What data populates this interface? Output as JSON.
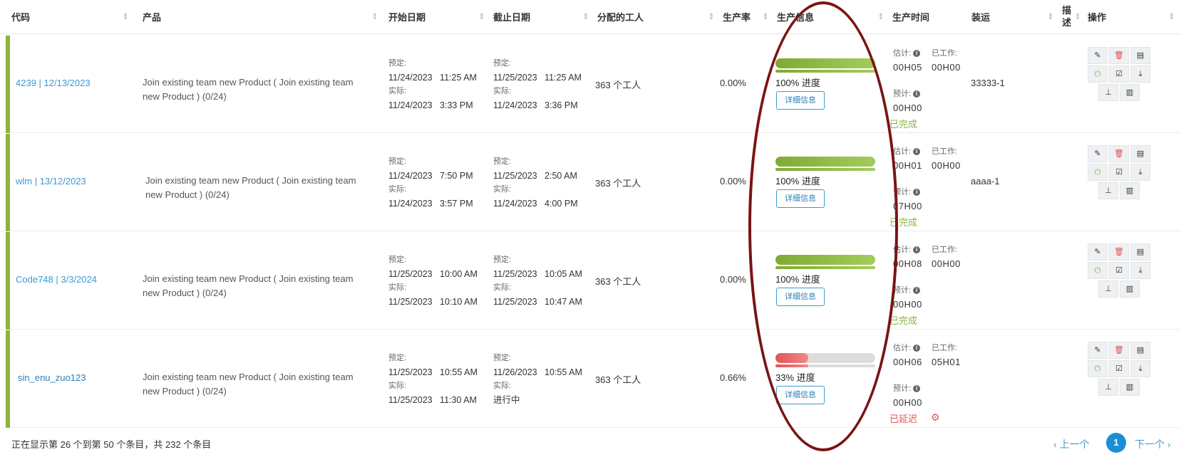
{
  "colors": {
    "accent": "#3c9ad0",
    "success": "#8ab43b",
    "danger": "#e05555",
    "annotation": "#7a1414"
  },
  "columns": [
    "代码",
    "产品",
    "开始日期",
    "截止日期",
    "分配的工人",
    "生产率",
    "生产信息",
    "生产时间",
    "装运",
    "描述",
    "操作"
  ],
  "labels": {
    "planned": "预定:",
    "actual": "实际:",
    "estimate": "估计:",
    "worked": "已工作:",
    "expected": "预计:",
    "detail": "详细信息"
  },
  "action_icons": [
    "edit-icon",
    "delete-icon",
    "file-icon",
    "power-icon",
    "check-icon",
    "download-icon",
    "hierarchy-icon",
    "barcode-icon"
  ],
  "rows": [
    {
      "code": "4239 | 12/13/2023",
      "product": "Join existing team new Product ( Join existing team new Product ) (0/24)",
      "start_planned": "11/24/2023   11:25 AM",
      "start_actual": "11/24/2023   3:33 PM",
      "end_planned": "11/25/2023   11:25 AM",
      "end_actual": "11/24/2023   3:36 PM",
      "workers": "363 个工人",
      "rate": "0.00%",
      "progress": 1.0,
      "progress_text": "100% 进度",
      "estimate": "00H05",
      "worked": "00H00",
      "expected": "00H00",
      "status": "已完成",
      "status_type": "ok",
      "shipping": "33333-1"
    },
    {
      "code": "wlm | 13/12/2023",
      "product": "Join existing team new Product ( Join existing team new Product ) (0/24)",
      "start_planned": "11/24/2023   7:50 PM",
      "start_actual": "11/24/2023   3:57 PM",
      "end_planned": "11/25/2023   2:50 AM",
      "end_actual": "11/24/2023   4:00 PM",
      "workers": "363 个工人",
      "rate": "0.00%",
      "progress": 1.0,
      "progress_text": "100% 进度",
      "estimate": "00H01",
      "worked": "00H00",
      "expected": "07H00",
      "status": "已完成",
      "status_type": "ok",
      "shipping": "aaaa-1"
    },
    {
      "code": "Code748 | 3/3/2024",
      "product": "Join existing team new Product ( Join existing team new Product ) (0/24)",
      "start_planned": "11/25/2023   10:00 AM",
      "start_actual": "11/25/2023   10:10 AM",
      "end_planned": "11/25/2023   10:05 AM",
      "end_actual": "11/25/2023   10:47 AM",
      "workers": "363 个工人",
      "rate": "0.00%",
      "progress": 1.0,
      "progress_text": "100% 进度",
      "estimate": "00H08",
      "worked": "00H00",
      "expected": "00H00",
      "status": "已完成",
      "status_type": "ok",
      "shipping": ""
    },
    {
      "code": "sin_enu_zuo123",
      "product": "Join existing team new Product ( Join existing team new Product ) (0/24)",
      "start_planned": "11/25/2023   10:55 AM",
      "start_actual": "11/25/2023   11:30 AM",
      "end_planned": "11/26/2023   10:55 AM",
      "end_actual": "进行中",
      "workers": "363 个工人",
      "rate": "0.66%",
      "progress": 0.33,
      "progress_text": "33% 进度",
      "estimate": "00H06",
      "worked": "05H01",
      "expected": "00H00",
      "status": "已延迟",
      "status_type": "late",
      "shipping": ""
    }
  ],
  "footer": {
    "summary": "正在显示第 26 个到第 50 个条目，共 232 个条目",
    "prev": "‹ 上一个",
    "current_page": "1",
    "next": "下一个 ›"
  }
}
